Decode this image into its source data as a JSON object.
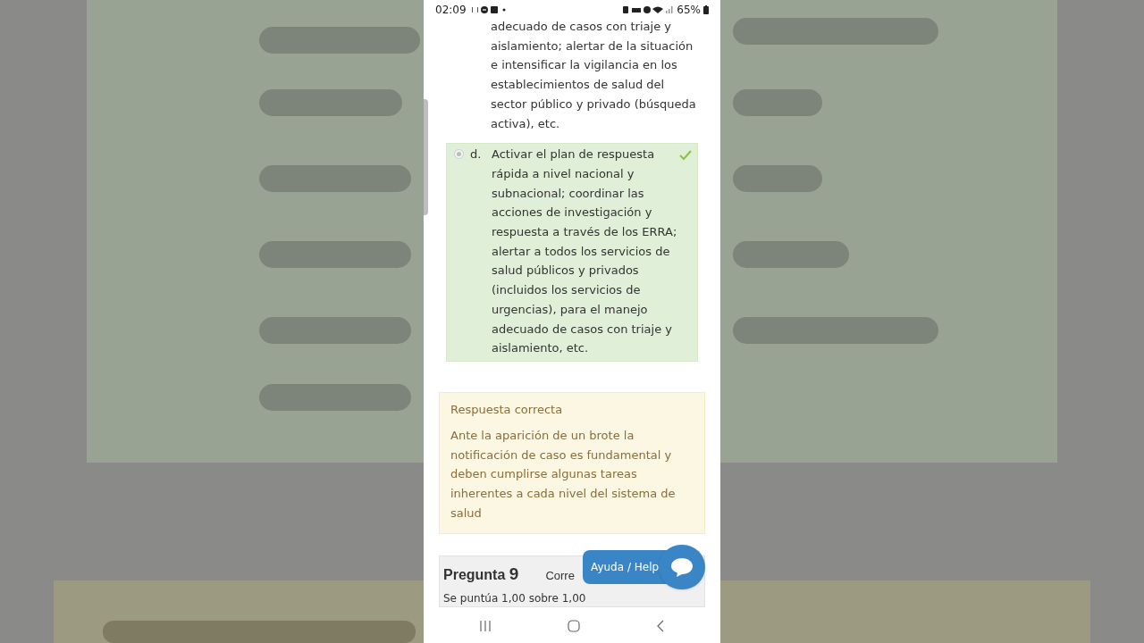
{
  "status_bar": {
    "time": "02:09",
    "battery": "65%"
  },
  "previous_option": {
    "text": "adecuado de casos con triaje y aislamiento; alertar de la situación e intensificar la vigilancia en los establecimientos de salud del sector público y privado (búsqueda activa), etc."
  },
  "option": {
    "letter": "d.",
    "text": "Activar el plan de respuesta rápida a nivel nacional y subnacional; coordinar las acciones de investigación y respuesta a través de los ERRA; alertar a todos los servicios de salud públicos y privados (incluidos los servicios de urgencias), para el manejo adecuado de casos con triaje y aislamiento, etc.",
    "selected": true,
    "correct": true
  },
  "feedback": {
    "title": "Respuesta correcta",
    "text": "Ante la aparición de un brote la notificación de caso es fundamental y deben cumplirse algunas tareas inherentes a cada nivel del sistema de salud"
  },
  "next_question": {
    "label": "Pregunta",
    "number": "9",
    "status": "Corre",
    "score": "Se puntúa 1,00 sobre 1,00"
  },
  "help_button": {
    "label": "Ayuda / Help"
  }
}
